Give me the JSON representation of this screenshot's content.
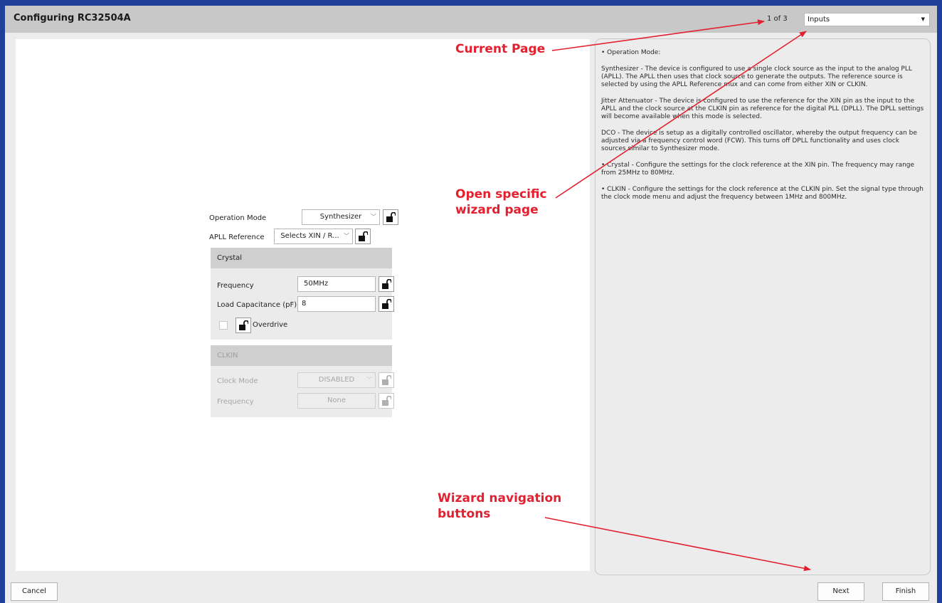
{
  "window": {
    "title": "Configuring RC32504A"
  },
  "pager": {
    "count": "1 of 3",
    "selected_page": "Inputs"
  },
  "form": {
    "operation_mode": {
      "label": "Operation Mode",
      "value": "Synthesizer"
    },
    "apll_reference": {
      "label": "APLL Reference",
      "value": "Selects XIN / R..."
    },
    "crystal": {
      "header": "Crystal",
      "frequency_label": "Frequency",
      "frequency_value": "50MHz",
      "load_cap_label": "Load Capacitance (pF)",
      "load_cap_value": "8",
      "overdrive_label": "Overdrive"
    },
    "clkin": {
      "header": "CLKIN",
      "clock_mode_label": "Clock Mode",
      "clock_mode_value": "DISABLED",
      "frequency_label": "Frequency",
      "frequency_value": "None"
    }
  },
  "help": {
    "operation_mode_heading": "• Operation Mode:",
    "synthesizer": "Synthesizer - The device is configured to use a single clock source as the input to the analog PLL (APLL). The APLL then uses that clock source to generate the outputs. The reference source is selected by using the APLL Reference mux and can come from either XIN or CLKIN.",
    "jitter_attenuator": "Jitter Attenuator - The device is configured to use the reference for the XIN pin as the input to the APLL and the clock source at the CLKIN pin as reference for the digital PLL (DPLL). The DPLL settings will become available when this mode is selected.",
    "dco": "DCO - The device is setup as a digitally controlled oscillator, whereby the output frequency can be adjusted via a frequency control word (FCW). This turns off DPLL functionality and uses clock sources similar to Synthesizer mode.",
    "crystal": "• Crystal - Configure the settings for the clock reference at the XIN pin. The frequency may range from 25MHz to 80MHz.",
    "clkin": "• CLKIN - Configure the settings for the clock reference at the CLKIN pin. Set the signal type through the clock mode menu and adjust the frequency between 1MHz and 800MHz."
  },
  "buttons": {
    "cancel": "Cancel",
    "next": "Next",
    "finish": "Finish"
  },
  "annotations": {
    "current_page": "Current Page",
    "open_specific_line1": "Open specific",
    "open_specific_line2": "wizard page",
    "wizard_nav_line1": "Wizard navigation",
    "wizard_nav_line2": "buttons"
  },
  "icons": {
    "lock": "unlock-icon",
    "dropdown": "chevron-down-icon"
  },
  "colors": {
    "annotation": "#e3202f",
    "frame_border": "#1f3f9a"
  }
}
